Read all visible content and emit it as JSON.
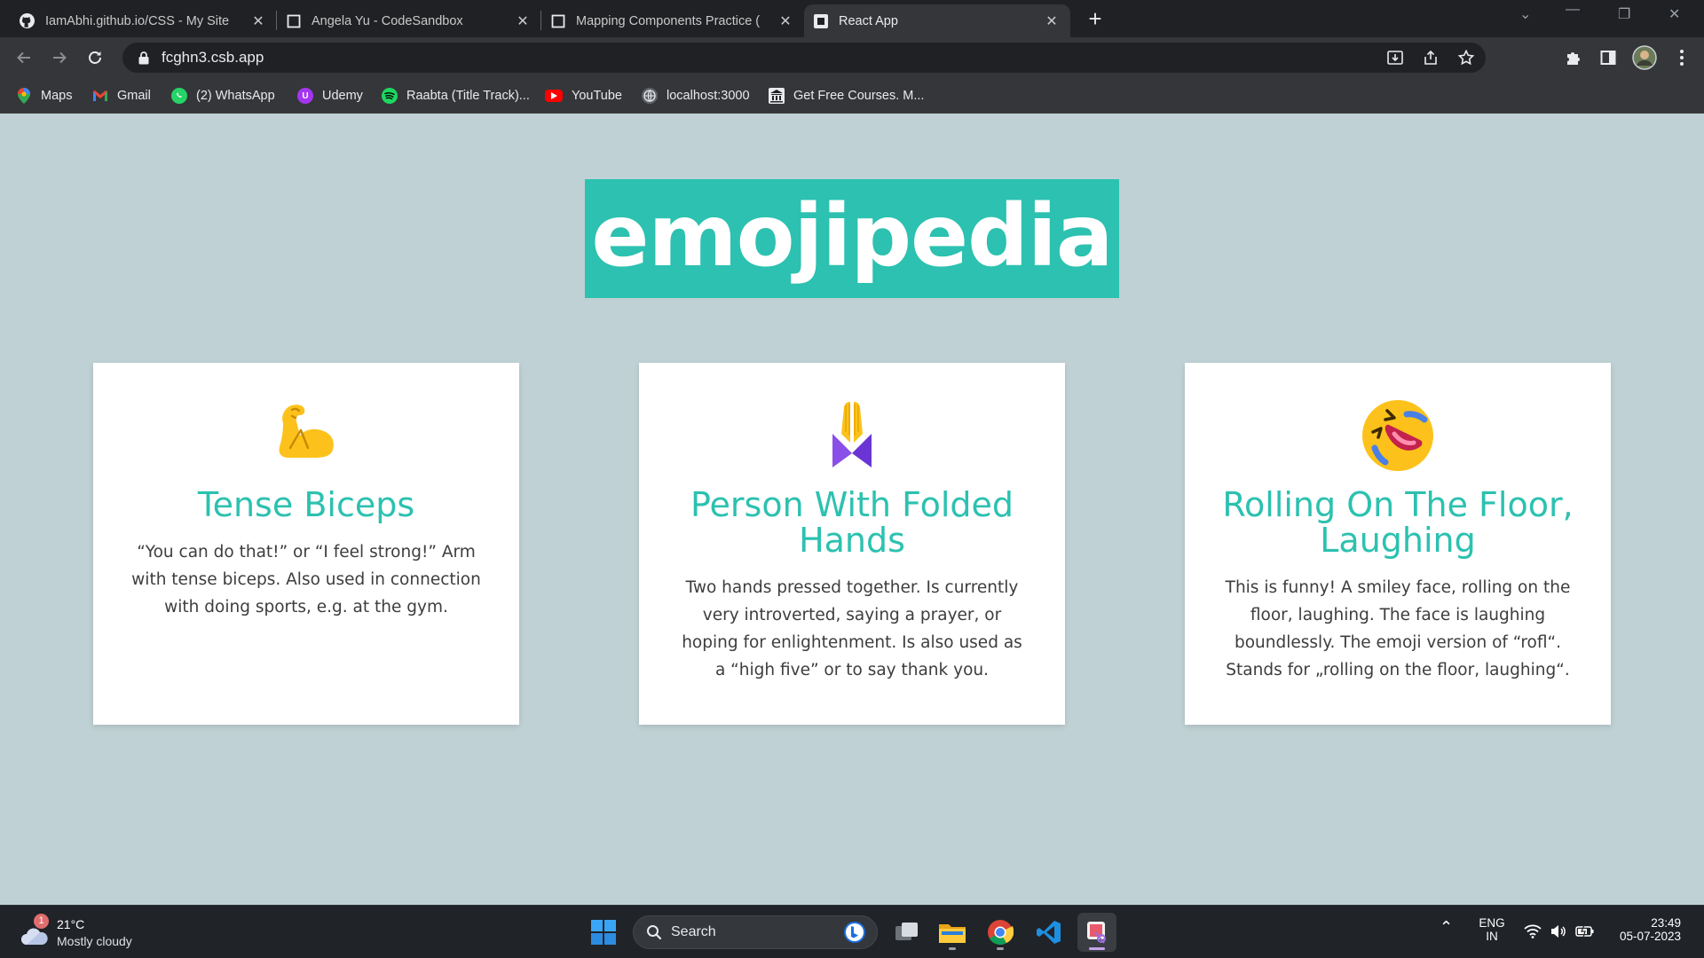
{
  "browser": {
    "tabs": [
      {
        "title": "IamAbhi.github.io/CSS - My Site",
        "icon": "github-icon"
      },
      {
        "title": "Angela Yu - CodeSandbox",
        "icon": "codesandbox-icon"
      },
      {
        "title": "Mapping Components Practice (",
        "icon": "codesandbox-icon"
      },
      {
        "title": "React App",
        "icon": "react-app-icon",
        "active": true
      }
    ],
    "url": "fcghn3.csb.app",
    "bookmarks": [
      {
        "label": "Maps"
      },
      {
        "label": "Gmail"
      },
      {
        "label": "(2) WhatsApp"
      },
      {
        "label": "Udemy"
      },
      {
        "label": "Raabta (Title Track)..."
      },
      {
        "label": "YouTube"
      },
      {
        "label": "localhost:3000"
      },
      {
        "label": "Get Free Courses. M..."
      }
    ]
  },
  "page": {
    "title": "emojipedia",
    "accent_color": "#2cc1b0",
    "background_color": "#bfd1d4",
    "cards": [
      {
        "emoji": "💪",
        "emoji_icon": "flexed-biceps-icon",
        "name": "Tense Biceps",
        "meaning": "“You can do that!” or “I feel strong!” Arm with tense biceps. Also used in connection with doing sports, e.g. at the gym."
      },
      {
        "emoji": "🙏",
        "emoji_icon": "folded-hands-icon",
        "name": "Person With Folded Hands",
        "meaning": "Two hands pressed together. Is currently very introverted, saying a prayer, or hoping for enlightenment. Is also used as a “high five” or to say thank you."
      },
      {
        "emoji": "🤣",
        "emoji_icon": "rofl-face-icon",
        "name": "Rolling On The Floor, Laughing",
        "meaning": "This is funny! A smiley face, rolling on the floor, laughing. The face is laughing boundlessly. The emoji version of “rofl“. Stands for „rolling on the floor, laughing“."
      }
    ]
  },
  "taskbar": {
    "weather": {
      "temp": "21°C",
      "condition": "Mostly cloudy",
      "badge": "1"
    },
    "search_label": "Search",
    "lang": {
      "line1": "ENG",
      "line2": "IN"
    },
    "clock": {
      "time": "23:49",
      "date": "05-07-2023"
    }
  }
}
